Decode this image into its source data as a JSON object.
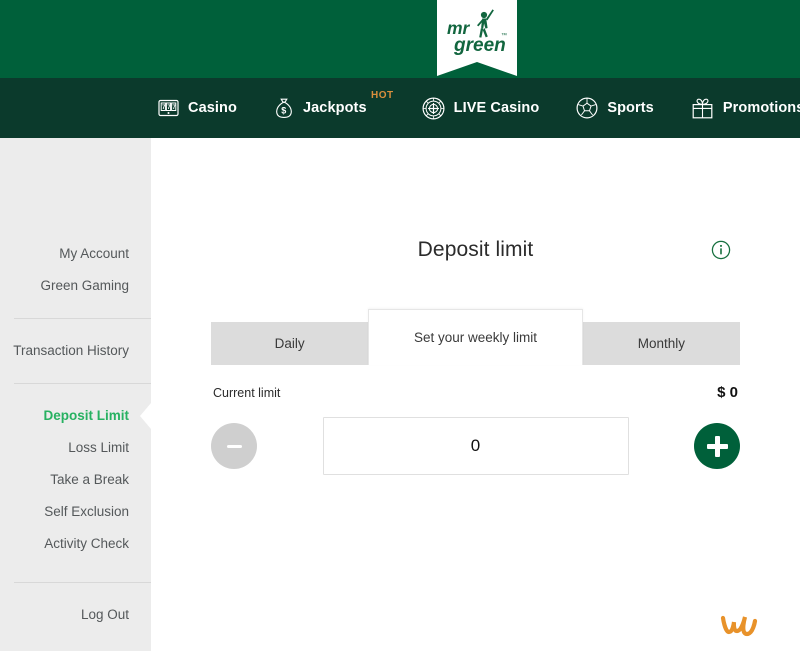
{
  "brand": {
    "logo_line1": "mr",
    "logo_line2": "green",
    "logo_name": "mr-green-logo",
    "trademark": "™"
  },
  "nav": {
    "items": [
      {
        "label": "Casino",
        "icon": "slot-machine-icon",
        "badge": ""
      },
      {
        "label": "Jackpots",
        "icon": "money-bag-icon",
        "badge": "HOT"
      },
      {
        "label": "LIVE Casino",
        "icon": "roulette-wheel-icon",
        "badge": ""
      },
      {
        "label": "Sports",
        "icon": "soccer-ball-icon",
        "badge": ""
      },
      {
        "label": "Promotions",
        "icon": "gift-box-icon",
        "badge": ""
      }
    ]
  },
  "sidebar": {
    "group1": [
      {
        "label": "My Account",
        "active": false
      },
      {
        "label": "Green Gaming",
        "active": false
      }
    ],
    "group2": [
      {
        "label": "Transaction History",
        "active": false
      }
    ],
    "group3": [
      {
        "label": "Deposit Limit",
        "active": true
      },
      {
        "label": "Loss Limit",
        "active": false
      },
      {
        "label": "Take a Break",
        "active": false
      },
      {
        "label": "Self Exclusion",
        "active": false
      },
      {
        "label": "Activity Check",
        "active": false
      }
    ],
    "group4": [
      {
        "label": "Log Out",
        "active": false
      }
    ]
  },
  "main": {
    "title": "Deposit limit",
    "info_icon": "info-circle-icon",
    "tabs": [
      {
        "label": "Daily",
        "active": false
      },
      {
        "label": "Set your weekly limit",
        "active": true
      },
      {
        "label": "Monthly",
        "active": false
      }
    ],
    "current_limit_label": "Current limit",
    "current_limit_value": "$ 0",
    "amount_value": "0",
    "amount_placeholder": "0",
    "decrement_label": "−",
    "increment_label": "+"
  },
  "footer": {
    "logo_name": "w-partner-logo"
  },
  "colors": {
    "brand_green": "#00603a",
    "nav_green": "#0b3a2c",
    "accent_green": "#27b161",
    "sidebar_bg": "#ececec",
    "tab_inactive": "#dcdcdc",
    "hot_orange": "#d98f3d",
    "footer_orange": "#e8922a"
  }
}
